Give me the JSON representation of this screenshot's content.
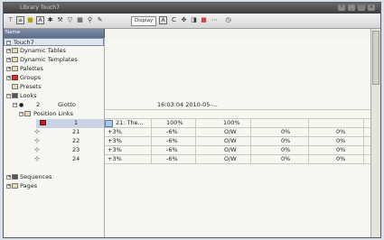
{
  "window": {
    "title": "Library Touch7"
  },
  "toolbar": {
    "display_label": "Display"
  },
  "tree_header": "Name",
  "tree": {
    "root": "Touch7",
    "dynamic_tables": "Dynamic Tables",
    "dynamic_templates": "Dynamic Templates",
    "palettes": "Palettes",
    "groups": "Groups",
    "presets": "Presets",
    "looks": "Looks",
    "look_number": "2",
    "look_name": "Giotto",
    "position_links": "Position Links",
    "link_rows": [
      {
        "num": "1"
      },
      {
        "num": "21"
      },
      {
        "num": "22"
      },
      {
        "num": "23"
      },
      {
        "num": "24"
      }
    ],
    "sequences": "Sequences",
    "pages": "Pages"
  },
  "grid": {
    "look_timestamp": "16:03:04 2010-05-...",
    "row1": {
      "name": "21: The...",
      "v1": "100%",
      "v2": "100%"
    },
    "rows": [
      {
        "a": "+3%",
        "b": "-6%",
        "c": "O/W",
        "d": "0%",
        "e": "0%"
      },
      {
        "a": "+3%",
        "b": "-6%",
        "c": "O/W",
        "d": "0%",
        "e": "0%"
      },
      {
        "a": "+3%",
        "b": "-6%",
        "c": "O/W",
        "d": "0%",
        "e": "0%"
      },
      {
        "a": "+3%",
        "b": "-6%",
        "c": "O/W",
        "d": "0%",
        "e": "0%"
      }
    ]
  }
}
